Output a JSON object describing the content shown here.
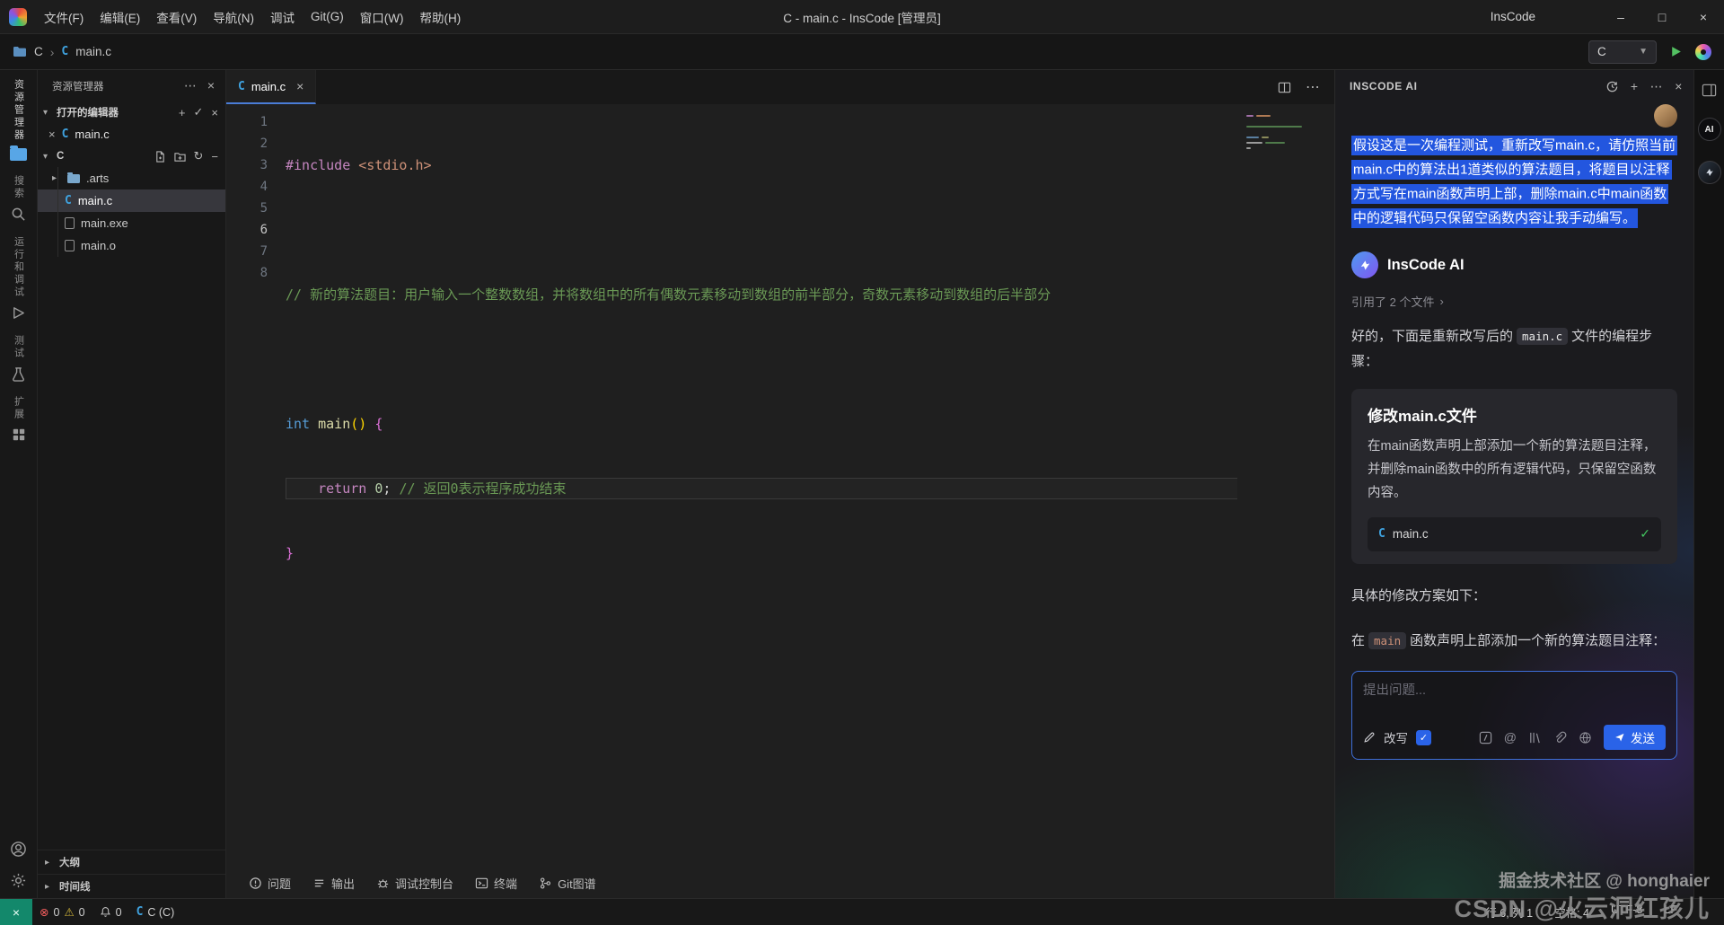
{
  "titlebar": {
    "menus": [
      "文件(F)",
      "编辑(E)",
      "查看(V)",
      "导航(N)",
      "调试",
      "Git(G)",
      "窗口(W)",
      "帮助(H)"
    ],
    "title": "C - main.c - InsCode [管理员]",
    "product": "InsCode",
    "window_controls": {
      "minimize": "–",
      "maximize": "□",
      "close": "×"
    }
  },
  "navbar": {
    "breadcrumb_root": "C",
    "breadcrumb_file": "main.c",
    "run_target": "C"
  },
  "activitybar": {
    "explorer_label": "资源管理器",
    "search_label": "搜索",
    "run_debug_label": "运行和调试",
    "testing_label": "测试",
    "extensions_label": "扩展"
  },
  "sidebar": {
    "title": "资源管理器",
    "open_editors_label": "打开的编辑器",
    "open_editor_file": "main.c",
    "workspace": "C",
    "tree": [
      {
        "name": ".arts"
      },
      {
        "name": "main.c"
      },
      {
        "name": "main.exe"
      },
      {
        "name": "main.o"
      }
    ],
    "outline_label": "大纲",
    "timeline_label": "时间线"
  },
  "editor": {
    "tab": "main.c",
    "line_numbers": [
      "1",
      "2",
      "3",
      "4",
      "5",
      "6",
      "7",
      "8"
    ],
    "code": {
      "l1": {
        "pp": "#include ",
        "str": "<stdio.h>"
      },
      "l3": {
        "com": "// 新的算法题目：用户输入一个整数数组，并将数组中的所有偶数元素移动到数组的前半部分，奇数元素移动到数组的后半部分"
      },
      "l5": {
        "kw": "int ",
        "fn": "main",
        "paren": "()",
        "brace": " {"
      },
      "l6": {
        "ctrl": "    return ",
        "num": "0",
        "semi": "; ",
        "com": "// 返回0表示程序成功结束"
      },
      "l7": {
        "brace": "}"
      }
    }
  },
  "panel": {
    "tabs": [
      {
        "label": "问题"
      },
      {
        "label": "输出"
      },
      {
        "label": "调试控制台"
      },
      {
        "label": "终端"
      },
      {
        "label": "Git图谱"
      }
    ]
  },
  "ai": {
    "header": "INSCODE AI",
    "user_message": "假设这是一次编程测试，重新改写main.c，请仿照当前main.c中的算法出1道类似的算法题目，将题目以注释方式写在main函数声明上部，删除main.c中main函数中的逻辑代码只保留空函数内容让我手动编写。",
    "assistant": "InsCode AI",
    "references": "引用了 2 个文件",
    "intro_prefix": "好的，下面是重新改写后的",
    "intro_code": "main.c",
    "intro_suffix": "文件的编程步骤：",
    "card_title": "修改main.c文件",
    "card_body": "在main函数声明上部添加一个新的算法题目注释，并删除main函数中的所有逻辑代码，只保留空函数内容。",
    "card_file": "main.c",
    "plan": "具体的修改方案如下：",
    "step_prefix": "在",
    "step_code": "main",
    "step_suffix": "函数声明上部添加一个新的算法题目注释：",
    "input_placeholder": "提出问题...",
    "rewrite": "改写",
    "send": "发送"
  },
  "statusbar": {
    "errors": "0",
    "warnings": "0",
    "notifications": "0",
    "language": "C (C)",
    "cursor": "行 6, 列 1",
    "indent": "空格: 4",
    "encoding": "UTF-8",
    "eol": "LF"
  },
  "watermarks": {
    "juejin": "掘金技术社区 @ honghaier",
    "csdn": "CSDN @火云洞红孩儿"
  }
}
